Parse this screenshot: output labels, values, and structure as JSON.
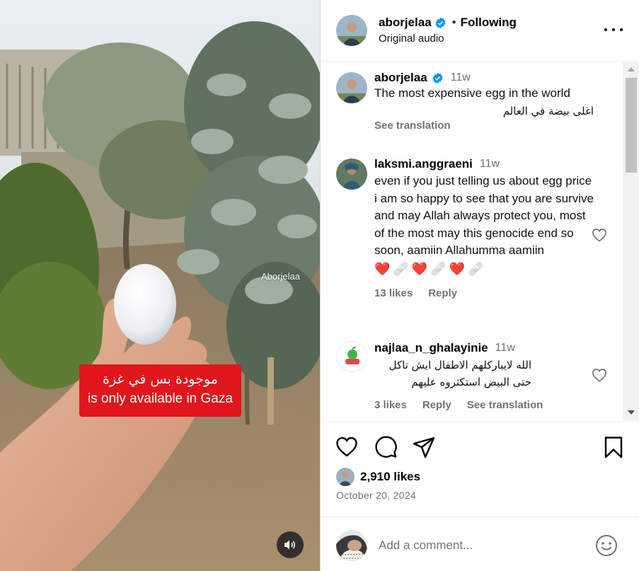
{
  "media": {
    "watermark": "Aborjelaa",
    "caption_ar": "موجودة بس في غزة",
    "caption_en": "is only available in Gaza",
    "audio_icon": "speaker-icon"
  },
  "header": {
    "username": "aborjelaa",
    "separator": "•",
    "follow_status": "Following",
    "subtitle": "Original audio"
  },
  "comments": [
    {
      "username": "aborjelaa",
      "time": "11w",
      "verified": true,
      "lines": [
        "The most expensive egg in the world"
      ],
      "ar_line": "اغلى بيضة في العالم",
      "meta": [
        "See translation"
      ]
    },
    {
      "username": "laksmi.anggraeni",
      "time": "11w",
      "text": "even if you just telling us about egg price i am so happy to see that you are survive and may Allah always protect you, most of the most may this genocide end so soon, aamiin Allahumma aamiin",
      "emojis": [
        "❤️",
        "🩹",
        "❤️",
        "🩹",
        "❤️",
        "🩹"
      ],
      "meta": [
        "13 likes",
        "Reply"
      ]
    },
    {
      "username": "najlaa_n_ghalayinie",
      "time": "11w",
      "text": "الله لايباركلهم الاطفال ايش تاكل حتى البيض استكثروه عليهم",
      "meta": [
        "3 likes",
        "Reply",
        "See translation"
      ]
    }
  ],
  "actions": {
    "likes": "2,910 likes",
    "date": "October 20, 2024"
  },
  "add_comment": {
    "placeholder": "Add a comment..."
  },
  "colors": {
    "verified": "#0095f6",
    "secondary_text": "#737373",
    "caption_bg": "#e0161c"
  }
}
